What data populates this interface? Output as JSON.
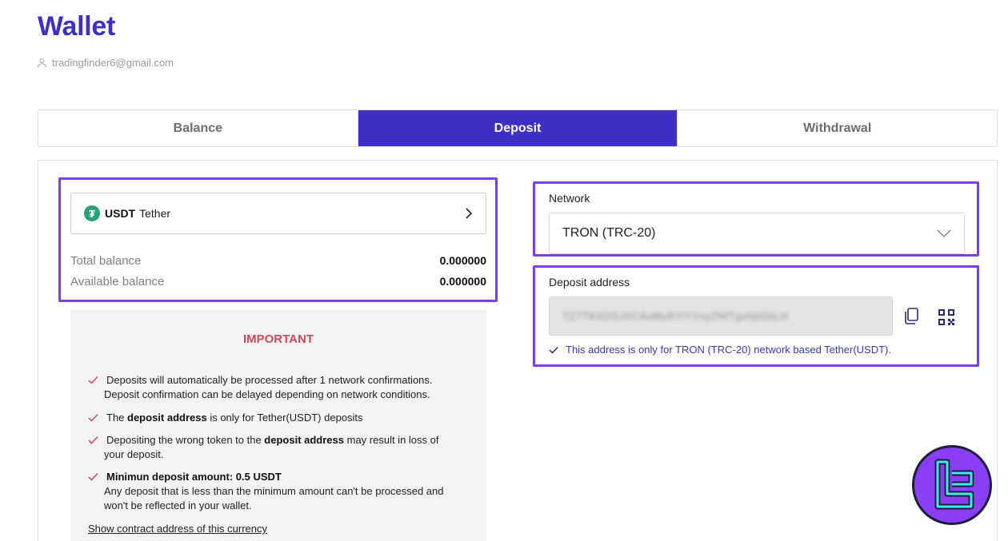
{
  "header": {
    "title": "Wallet",
    "user_email": "tradingfinder6@gmail.com"
  },
  "tabs": [
    {
      "label": "Balance",
      "active": false
    },
    {
      "label": "Deposit",
      "active": true
    },
    {
      "label": "Withdrawal",
      "active": false
    }
  ],
  "currency": {
    "code": "USDT",
    "name": "Tether",
    "icon": "tether-icon",
    "icon_glyph": "₮",
    "icon_color": "#26a17b"
  },
  "balances": {
    "total_label": "Total balance",
    "total_value": "0.000000",
    "available_label": "Available balance",
    "available_value": "0.000000"
  },
  "important": {
    "title": "IMPORTANT",
    "notice1_line1": "Deposits will automatically be processed after 1 network confirmations.",
    "notice1_line2": "Deposit confirmation can be delayed depending on network conditions.",
    "notice2_pre": "The ",
    "notice2_bold": "deposit address",
    "notice2_post": " is only for Tether(USDT) deposits",
    "notice3_pre": "Depositing the wrong token to the ",
    "notice3_bold": "deposit address",
    "notice3_post": " may result in loss of",
    "notice3_line2": "your deposit.",
    "notice4_bold": "Minimun deposit amount: 0.5 USDT",
    "notice4_line2": "Any deposit that is less than the minimum amount can't be processed and",
    "notice4_line3": "won't be reflected in your wallet.",
    "contract_link": "Show contract address of this currency"
  },
  "network": {
    "label": "Network",
    "selected": "TRON (TRC-20)"
  },
  "deposit": {
    "label": "Deposit address",
    "address": "TZ7TKSDSJXCAvMuRYiYVxyZNfTgxhjtGbLH",
    "note": "This address is only for TRON (TRC-20) network based Tether(USDT)."
  },
  "colors": {
    "brand": "#3f2fc4",
    "highlight": "#7a3ef0",
    "important_red": "#d1485b",
    "check_red": "#d1485b"
  }
}
